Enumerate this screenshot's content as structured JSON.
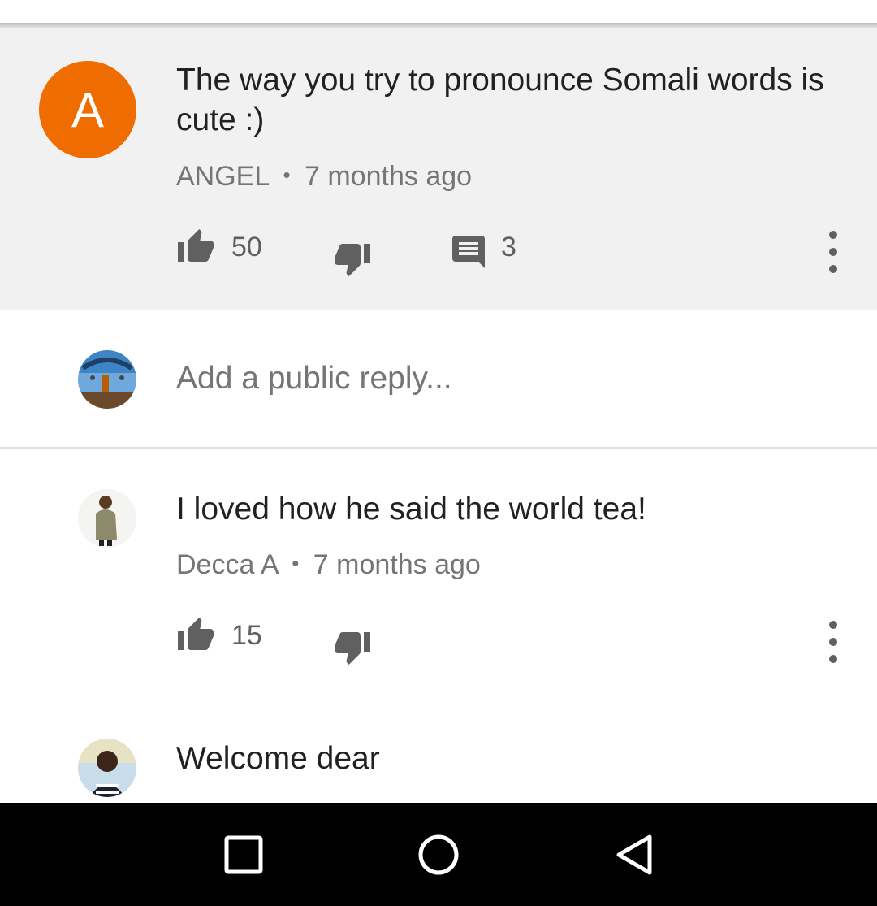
{
  "parent_comment": {
    "avatar_letter": "A",
    "avatar_color": "#ef6c00",
    "text": "The way you try to pronounce Somali words is cute :)",
    "author": "ANGEL",
    "separator": "•",
    "time": "7 months ago",
    "likes": "50",
    "replies": "3"
  },
  "reply_box": {
    "placeholder": "Add a public reply..."
  },
  "replies": [
    {
      "text": "I loved how he said the world tea!",
      "author": "Decca A",
      "separator": "•",
      "time": "7 months ago",
      "likes": "15"
    },
    {
      "text": "Welcome dear"
    }
  ],
  "icons": {
    "like": "thumb-up-icon",
    "dislike": "thumb-down-icon",
    "reply": "comment-icon",
    "more": "more-vert-icon",
    "nav_recents": "square-icon",
    "nav_home": "circle-icon",
    "nav_back": "triangle-back-icon"
  }
}
